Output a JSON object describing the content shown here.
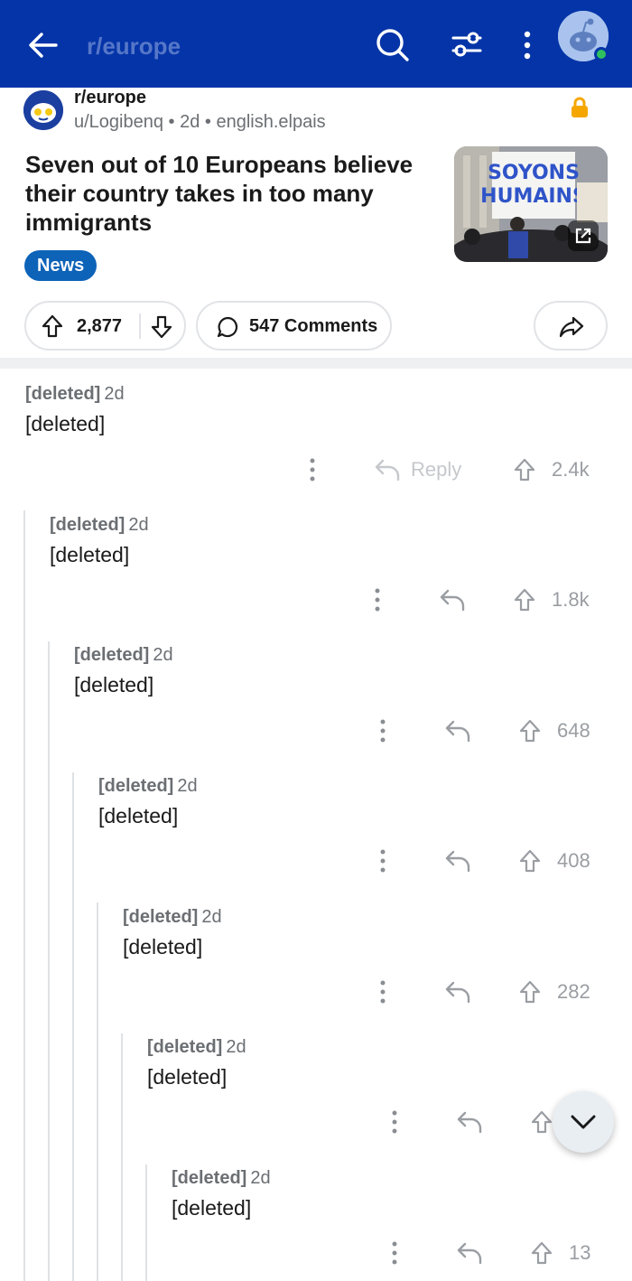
{
  "topbar": {
    "title": "r/europe",
    "colors": {
      "background": "#0434a8",
      "title": "#5677c8"
    }
  },
  "post": {
    "subreddit": "r/europe",
    "meta": "u/Logibenq • 2d • english.elpais",
    "title": "Seven out of 10 Europeans believe their country takes in too many immigrants",
    "flair": "News",
    "thumbnail_text": "SOYONS HUMAINS",
    "score": "2,877",
    "comments_label": "547 Comments"
  },
  "comments": [
    {
      "author": "[deleted]",
      "time": "2d",
      "body": "[deleted]",
      "reply_label": "Reply",
      "score": "2.4k"
    },
    {
      "author": "[deleted]",
      "time": "2d",
      "body": "[deleted]",
      "score": "1.8k"
    },
    {
      "author": "[deleted]",
      "time": "2d",
      "body": "[deleted]",
      "score": "648"
    },
    {
      "author": "[deleted]",
      "time": "2d",
      "body": "[deleted]",
      "score": "408"
    },
    {
      "author": "[deleted]",
      "time": "2d",
      "body": "[deleted]",
      "score": "282"
    },
    {
      "author": "[deleted]",
      "time": "2d",
      "body": "[deleted]",
      "score": ""
    },
    {
      "author": "[deleted]",
      "time": "2d",
      "body": "[deleted]",
      "score": "13"
    }
  ],
  "icons": [
    "back-arrow-icon",
    "search-icon",
    "filter-icon",
    "more-vertical-icon",
    "avatar",
    "lock-icon",
    "upvote-icon",
    "downvote-icon",
    "comment-icon",
    "share-icon",
    "reply-icon",
    "external-link-icon",
    "chevron-down-icon"
  ]
}
